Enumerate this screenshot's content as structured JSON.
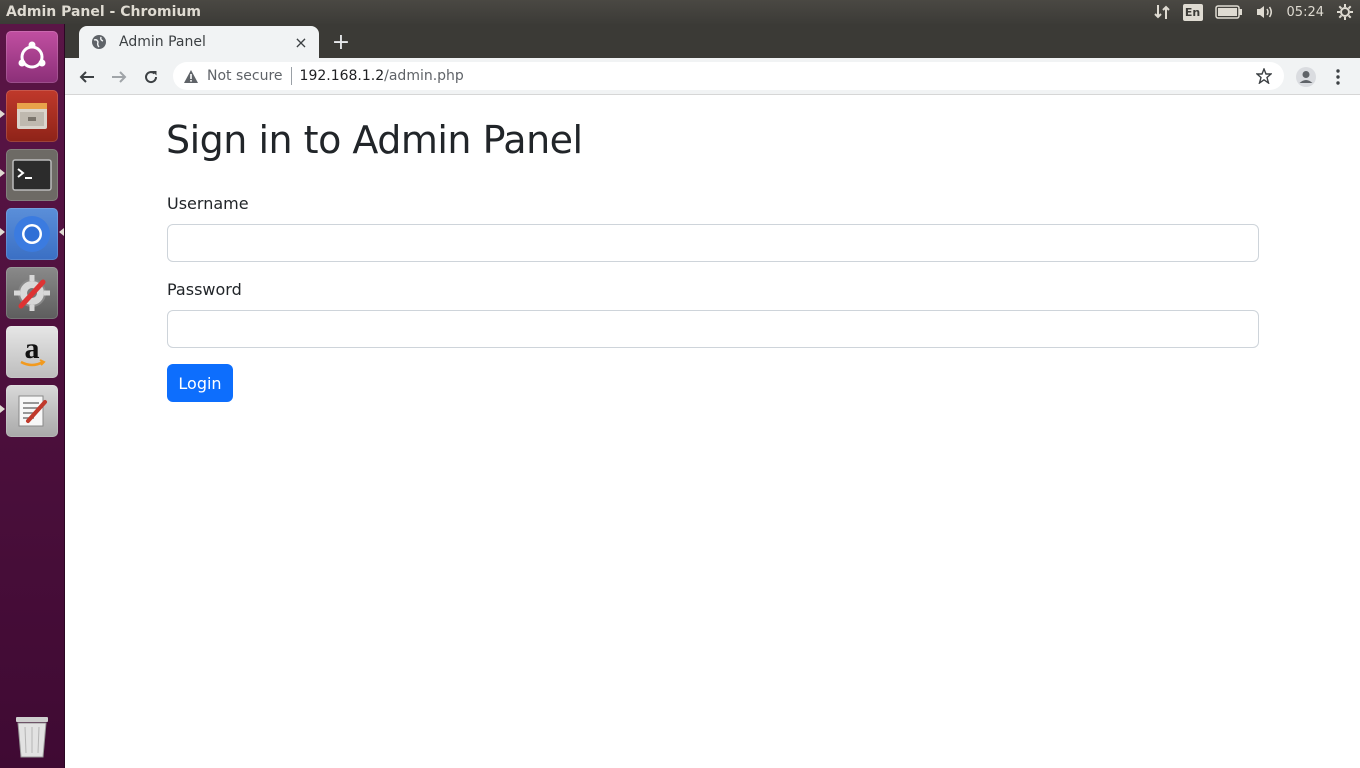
{
  "top_panel": {
    "window_title": "Admin Panel - Chromium",
    "language": "En",
    "clock": "05:24"
  },
  "launcher": {
    "items": [
      "ubuntu-dash-icon",
      "files-icon",
      "terminal-icon",
      "chromium-icon",
      "system-settings-icon",
      "amazon-icon",
      "text-editor-icon"
    ],
    "trash": "trash-icon"
  },
  "browser": {
    "tab": {
      "title": "Admin Panel",
      "close": "×"
    },
    "new_tab": "+",
    "omnibox": {
      "security_label": "Not secure",
      "url_host": "192.168.1.2",
      "url_path": "/admin.php"
    }
  },
  "page": {
    "title": "Sign in to Admin Panel",
    "username_label": "Username",
    "username_value": "",
    "password_label": "Password",
    "password_value": "",
    "login_label": "Login",
    "button_color": "#0d6efd"
  }
}
